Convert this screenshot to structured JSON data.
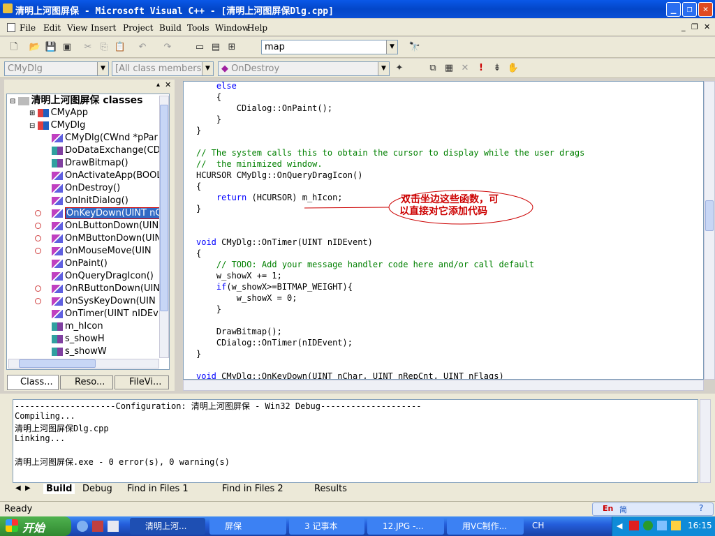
{
  "window": {
    "title": "清明上河图屏保 - Microsoft Visual C++ - [清明上河图屏保Dlg.cpp]"
  },
  "menu": [
    "File",
    "Edit",
    "View",
    "Insert",
    "Project",
    "Build",
    "Tools",
    "Window",
    "Help"
  ],
  "toolbar": {
    "find_combo": "map"
  },
  "wizardbar": {
    "class_combo": "CMyDlg",
    "filter_combo": "[All class members]",
    "member_combo": "OnDestroy"
  },
  "tree": {
    "root": "清明上河图屏保 classes",
    "nodes": [
      "CMyApp",
      "CMyDlg",
      "CMyDlg(CWnd *pPar",
      "DoDataExchange(CD",
      "DrawBitmap()",
      "OnActivateApp(BOOL",
      "OnDestroy()",
      "OnInitDialog()",
      "OnKeyDown(UINT nChar, UINT nRepCnt, UINT nFlags)",
      "OnLButtonDown(UIN",
      "OnMButtonDown(UIN",
      "OnMouseMove(UIN",
      "OnPaint()",
      "OnQueryDragIcon()",
      "OnRButtonDown(UIN",
      "OnSysKeyDown(UIN",
      "OnTimer(UINT nIDEv",
      "m_hIcon",
      "s_showH",
      "s_showW"
    ]
  },
  "left_tabs": [
    "Class...",
    "Reso...",
    "FileVi..."
  ],
  "code_lines": [
    "    else",
    "    {",
    "        CDialog::OnPaint();",
    "    }",
    "}",
    "",
    "// The system calls this to obtain the cursor to display while the user drags",
    "//  the minimized window.",
    "HCURSOR CMyDlg::OnQueryDragIcon()",
    "{",
    "    return (HCURSOR) m_hIcon;",
    "}",
    "",
    "",
    "void CMyDlg::OnTimer(UINT nIDEvent)",
    "{",
    "    // TODO: Add your message handler code here and/or call default",
    "    w_showX += 1;",
    "    if(w_showX>=BITMAP_WEIGHT){",
    "        w_showX = 0;",
    "    }",
    "",
    "    DrawBitmap();",
    "    CDialog::OnTimer(nIDEvent);",
    "}",
    "",
    "void CMyDlg::OnKeyDown(UINT nChar, UINT nRepCnt, UINT nFlags)"
  ],
  "annotation": {
    "line1": "双击坐边这些函数，可",
    "line2": "以直接对它添加代码",
    "color": "#cc0000"
  },
  "output_lines": [
    "--------------------Configuration: 清明上河图屏保 - Win32 Debug--------------------",
    "Compiling...",
    "清明上河图屏保Dlg.cpp",
    "Linking...",
    "",
    "清明上河图屏保.exe - 0 error(s), 0 warning(s)"
  ],
  "output_tabs": [
    "Build",
    "Debug",
    "Find in Files 1",
    "Find in Files 2",
    "Results"
  ],
  "status": {
    "text": "Ready"
  },
  "taskbar": {
    "start": "开始",
    "tasks": [
      "清明上河...",
      "屏保",
      "3 记事本",
      "12.JPG -...",
      "用VC制作..."
    ],
    "tray_lang": "CH",
    "clock": "16:15"
  }
}
